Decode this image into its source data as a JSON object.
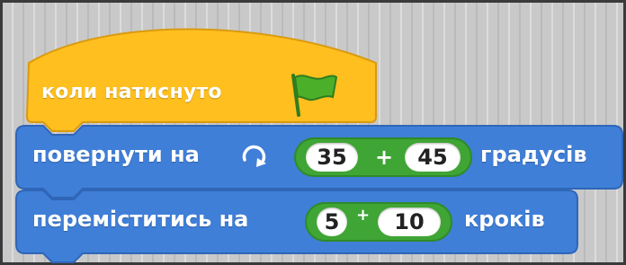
{
  "colors": {
    "events": "#ffbf1f",
    "motion": "#3f7fd8",
    "operators": "#3fa535",
    "canvas": "#c9c9c9"
  },
  "blocks": {
    "hat": {
      "label": "коли натиснуто",
      "icon": "green-flag-icon"
    },
    "turn": {
      "label": "повернути на",
      "icon": "rotate-clockwise-icon",
      "operand1": "35",
      "operator": "+",
      "operand2": "45",
      "suffix": "градусів"
    },
    "move": {
      "label": "переміститись на",
      "operand1": "5",
      "operator": "+",
      "operand2": "10",
      "suffix": "кроків"
    }
  }
}
